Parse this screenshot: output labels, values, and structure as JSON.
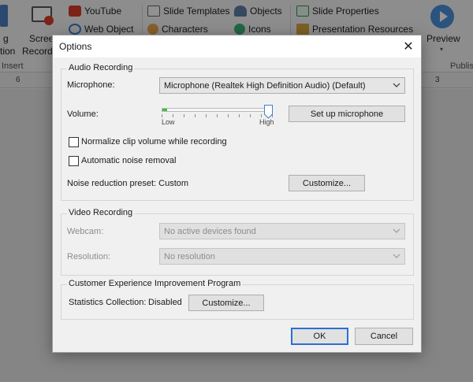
{
  "ribbon": {
    "youtube": "YouTube",
    "web_object": "Web Object",
    "slide_templates": "Slide Templates",
    "characters": "Characters",
    "objects": "Objects",
    "icons": "Icons",
    "slide_properties": "Slide Properties",
    "presentation_resources": "Presentation Resources",
    "preview": "Preview",
    "screen_recording_1": "Scree",
    "screen_recording_2": "Recordi",
    "left_frag_1": "g",
    "left_frag_2": "tion",
    "insert_label": "Insert",
    "publish_label": "Publis",
    "ruler_left": "6",
    "ruler_right": "3"
  },
  "dialog": {
    "title": "Options",
    "close": "✕",
    "audio": {
      "legend": "Audio Recording",
      "microphone_label": "Microphone:",
      "microphone_value": "Microphone (Realtek High Definition Audio) (Default)",
      "volume_label": "Volume:",
      "volume_level": 1.0,
      "low_label": "Low",
      "high_label": "High",
      "setup_button": "Set up microphone",
      "normalize_label": "Normalize clip volume while recording",
      "normalize_checked": false,
      "noise_removal_label": "Automatic noise removal",
      "noise_removal_checked": false,
      "noise_preset_label": "Noise reduction preset: Custom",
      "customize_button": "Customize..."
    },
    "video": {
      "legend": "Video Recording",
      "webcam_label": "Webcam:",
      "webcam_value": "No active devices found",
      "resolution_label": "Resolution:",
      "resolution_value": "No resolution"
    },
    "ceip": {
      "legend": "Customer Experience Improvement Program",
      "stats_label": "Statistics Collection:",
      "stats_value": "Disabled",
      "customize_button": "Customize..."
    },
    "ok_button": "OK",
    "cancel_button": "Cancel"
  },
  "colors": {
    "accent": "#2a6fd1",
    "volume_fill": "#3ac03a",
    "youtube_red": "#d83b2a",
    "preview_blue": "#4a8fd8"
  },
  "icons": {
    "youtube": "youtube-icon",
    "web_object": "web-object-icon",
    "slide_templates": "slide-templates-icon",
    "characters": "characters-icon",
    "objects": "objects-icon",
    "icons": "icons-icon",
    "slide_properties": "slide-properties-icon",
    "presentation_resources": "presentation-resources-icon",
    "preview": "preview-icon",
    "screen_recording": "screen-recording-icon"
  }
}
